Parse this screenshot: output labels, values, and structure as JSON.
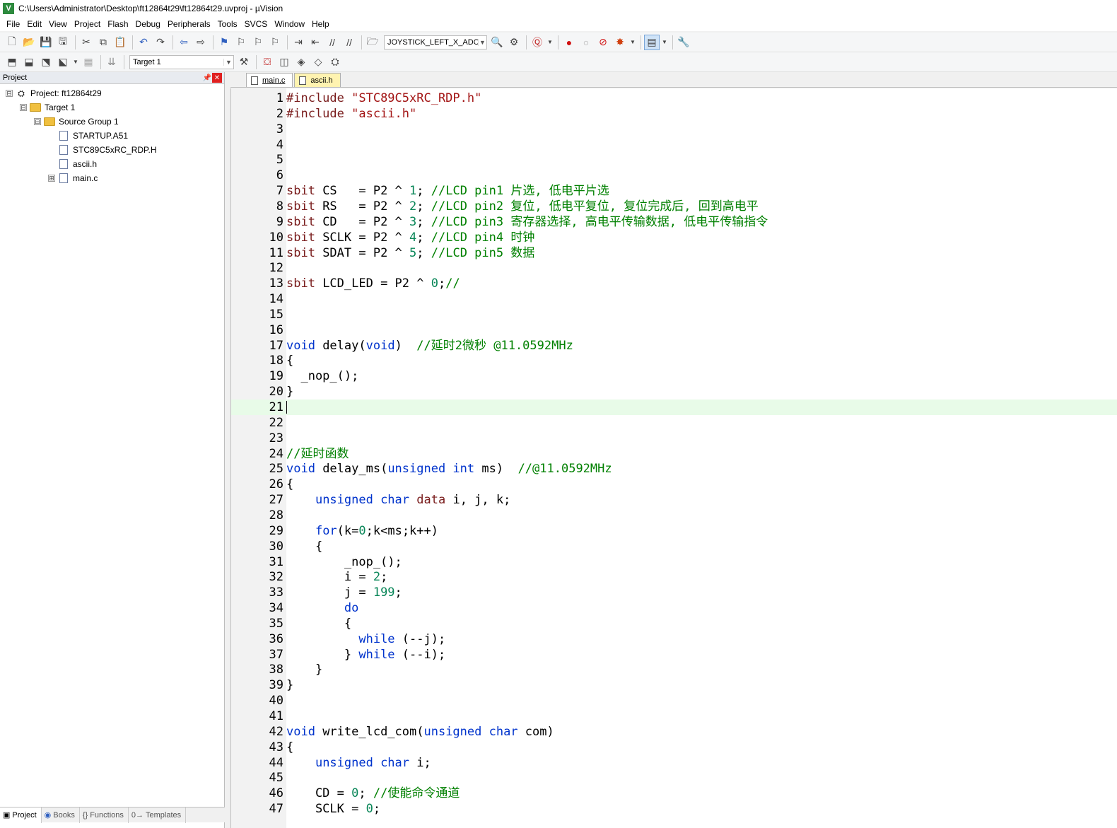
{
  "window": {
    "title": "C:\\Users\\Administrator\\Desktop\\ft12864t29\\ft12864t29.uvproj - µVision"
  },
  "menu": [
    "File",
    "Edit",
    "View",
    "Project",
    "Flash",
    "Debug",
    "Peripherals",
    "Tools",
    "SVCS",
    "Window",
    "Help"
  ],
  "toolbar": {
    "find_combo": "JOYSTICK_LEFT_X_ADC_CH",
    "target_combo": "Target 1"
  },
  "project_panel": {
    "title": "Project",
    "tree": [
      {
        "label": "Project: ft12864t29",
        "level": 0,
        "kind": "project",
        "expander": "⊟"
      },
      {
        "label": "Target 1",
        "level": 1,
        "kind": "target",
        "expander": "⊟"
      },
      {
        "label": "Source Group 1",
        "level": 2,
        "kind": "folder",
        "expander": "⊟"
      },
      {
        "label": "STARTUP.A51",
        "level": 3,
        "kind": "file",
        "expander": ""
      },
      {
        "label": "STC89C5xRC_RDP.H",
        "level": 3,
        "kind": "file",
        "expander": ""
      },
      {
        "label": "ascii.h",
        "level": 3,
        "kind": "file",
        "expander": ""
      },
      {
        "label": "main.c",
        "level": 3,
        "kind": "file",
        "expander": "⊞"
      }
    ],
    "tabs": [
      "Project",
      "Books",
      "Functions",
      "Templates"
    ]
  },
  "editor": {
    "tabs": [
      "main.c",
      "ascii.h"
    ],
    "active_tab": "main.c",
    "current_line": 21,
    "colors": {
      "keyword": "#0033cc",
      "preprocessor": "#7a1d1d",
      "string": "#a31515",
      "number": "#098658",
      "comment": "#008000",
      "current_line_bg": "#e8fbe8"
    },
    "lines": [
      {
        "n": "1",
        "t": [
          [
            "pp",
            "#include "
          ],
          [
            "str",
            "\"STC89C5xRC_RDP.h\""
          ]
        ]
      },
      {
        "n": "2",
        "t": [
          [
            "pp",
            "#include "
          ],
          [
            "str",
            "\"ascii.h\""
          ]
        ]
      },
      {
        "n": "3",
        "t": []
      },
      {
        "n": "4",
        "t": []
      },
      {
        "n": "5",
        "t": []
      },
      {
        "n": "6",
        "t": []
      },
      {
        "n": "7",
        "t": [
          [
            "pp",
            "sbit"
          ],
          [
            "tx",
            " CS   = P2 ^ "
          ],
          [
            "num",
            "1"
          ],
          [
            "tx",
            "; "
          ],
          [
            "cm",
            "//LCD pin1 片选, 低电平片选"
          ]
        ]
      },
      {
        "n": "8",
        "t": [
          [
            "pp",
            "sbit"
          ],
          [
            "tx",
            " RS   = P2 ^ "
          ],
          [
            "num",
            "2"
          ],
          [
            "tx",
            "; "
          ],
          [
            "cm",
            "//LCD pin2 复位, 低电平复位, 复位完成后, 回到高电平"
          ]
        ]
      },
      {
        "n": "9",
        "t": [
          [
            "pp",
            "sbit"
          ],
          [
            "tx",
            " CD   = P2 ^ "
          ],
          [
            "num",
            "3"
          ],
          [
            "tx",
            "; "
          ],
          [
            "cm",
            "//LCD pin3 寄存器选择, 高电平传输数据, 低电平传输指令"
          ]
        ]
      },
      {
        "n": "10",
        "t": [
          [
            "pp",
            "sbit"
          ],
          [
            "tx",
            " SCLK = P2 ^ "
          ],
          [
            "num",
            "4"
          ],
          [
            "tx",
            "; "
          ],
          [
            "cm",
            "//LCD pin4 时钟"
          ]
        ]
      },
      {
        "n": "11",
        "t": [
          [
            "pp",
            "sbit"
          ],
          [
            "tx",
            " SDAT = P2 ^ "
          ],
          [
            "num",
            "5"
          ],
          [
            "tx",
            "; "
          ],
          [
            "cm",
            "//LCD pin5 数据"
          ]
        ]
      },
      {
        "n": "12",
        "t": []
      },
      {
        "n": "13",
        "t": [
          [
            "pp",
            "sbit"
          ],
          [
            "tx",
            " LCD_LED = P2 ^ "
          ],
          [
            "num",
            "0"
          ],
          [
            "tx",
            ";"
          ],
          [
            "cm",
            "//"
          ]
        ]
      },
      {
        "n": "14",
        "t": []
      },
      {
        "n": "15",
        "t": []
      },
      {
        "n": "16",
        "t": []
      },
      {
        "n": "17",
        "t": [
          [
            "kw",
            "void"
          ],
          [
            "tx",
            " delay("
          ],
          [
            "kw",
            "void"
          ],
          [
            "tx",
            ")  "
          ],
          [
            "cm",
            "//延时2微秒 @11.0592MHz"
          ]
        ]
      },
      {
        "n": "18",
        "t": [
          [
            "tx",
            "{"
          ]
        ]
      },
      {
        "n": "19",
        "t": [
          [
            "tx",
            "  _nop_();"
          ]
        ]
      },
      {
        "n": "20",
        "t": [
          [
            "tx",
            "}"
          ]
        ]
      },
      {
        "n": "21",
        "t": []
      },
      {
        "n": "22",
        "t": []
      },
      {
        "n": "23",
        "t": []
      },
      {
        "n": "24",
        "t": [
          [
            "cm",
            "//延时函数"
          ]
        ]
      },
      {
        "n": "25",
        "t": [
          [
            "kw",
            "void"
          ],
          [
            "tx",
            " delay_ms("
          ],
          [
            "kw",
            "unsigned int"
          ],
          [
            "tx",
            " ms)  "
          ],
          [
            "cm",
            "//@11.0592MHz"
          ]
        ]
      },
      {
        "n": "26",
        "t": [
          [
            "tx",
            "{"
          ]
        ]
      },
      {
        "n": "27",
        "t": [
          [
            "tx",
            "    "
          ],
          [
            "kw",
            "unsigned char"
          ],
          [
            "tx",
            " "
          ],
          [
            "pp",
            "data"
          ],
          [
            "tx",
            " i, j, k;"
          ]
        ]
      },
      {
        "n": "28",
        "t": []
      },
      {
        "n": "29",
        "t": [
          [
            "tx",
            "    "
          ],
          [
            "kw",
            "for"
          ],
          [
            "tx",
            "(k="
          ],
          [
            "num",
            "0"
          ],
          [
            "tx",
            ";k<ms;k++)"
          ]
        ]
      },
      {
        "n": "30",
        "t": [
          [
            "tx",
            "    {"
          ]
        ]
      },
      {
        "n": "31",
        "t": [
          [
            "tx",
            "        _nop_();"
          ]
        ]
      },
      {
        "n": "32",
        "t": [
          [
            "tx",
            "        i = "
          ],
          [
            "num",
            "2"
          ],
          [
            "tx",
            ";"
          ]
        ]
      },
      {
        "n": "33",
        "t": [
          [
            "tx",
            "        j = "
          ],
          [
            "num",
            "199"
          ],
          [
            "tx",
            ";"
          ]
        ]
      },
      {
        "n": "34",
        "t": [
          [
            "tx",
            "        "
          ],
          [
            "kw",
            "do"
          ]
        ]
      },
      {
        "n": "35",
        "t": [
          [
            "tx",
            "        {"
          ]
        ]
      },
      {
        "n": "36",
        "t": [
          [
            "tx",
            "          "
          ],
          [
            "kw",
            "while"
          ],
          [
            "tx",
            " (--j);"
          ]
        ]
      },
      {
        "n": "37",
        "t": [
          [
            "tx",
            "        } "
          ],
          [
            "kw",
            "while"
          ],
          [
            "tx",
            " (--i);"
          ]
        ]
      },
      {
        "n": "38",
        "t": [
          [
            "tx",
            "    }"
          ]
        ]
      },
      {
        "n": "39",
        "t": [
          [
            "tx",
            "}"
          ]
        ]
      },
      {
        "n": "40",
        "t": []
      },
      {
        "n": "41",
        "t": []
      },
      {
        "n": "42",
        "t": [
          [
            "kw",
            "void"
          ],
          [
            "tx",
            " write_lcd_com("
          ],
          [
            "kw",
            "unsigned char"
          ],
          [
            "tx",
            " com)"
          ]
        ]
      },
      {
        "n": "43",
        "t": [
          [
            "tx",
            "{"
          ]
        ]
      },
      {
        "n": "44",
        "t": [
          [
            "tx",
            "    "
          ],
          [
            "kw",
            "unsigned char"
          ],
          [
            "tx",
            " i;"
          ]
        ]
      },
      {
        "n": "45",
        "t": []
      },
      {
        "n": "46",
        "t": [
          [
            "tx",
            "    CD = "
          ],
          [
            "num",
            "0"
          ],
          [
            "tx",
            "; "
          ],
          [
            "cm",
            "//使能命令通道"
          ]
        ]
      },
      {
        "n": "47",
        "t": [
          [
            "tx",
            "    SCLK = "
          ],
          [
            "num",
            "0"
          ],
          [
            "tx",
            ";"
          ]
        ]
      }
    ]
  }
}
